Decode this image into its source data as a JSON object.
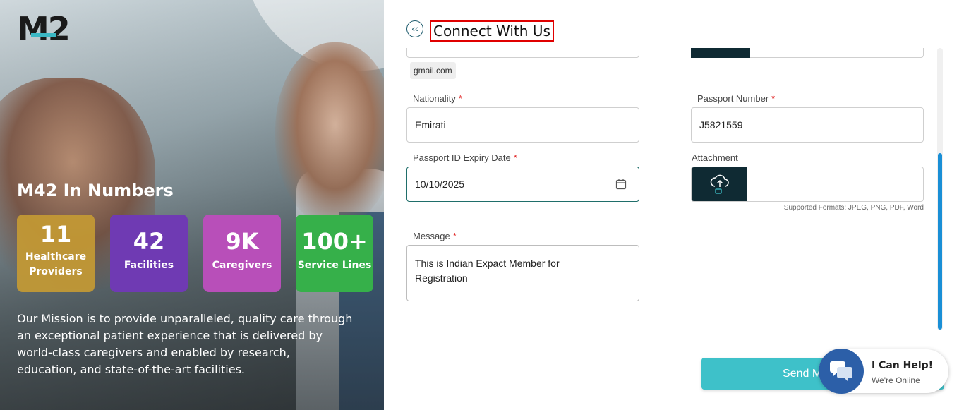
{
  "brand": {
    "logo_text": "M2"
  },
  "hero": {
    "title": "M42 In Numbers",
    "stats": [
      {
        "value": "11",
        "label_lines": [
          "Healthcare",
          "Providers"
        ],
        "color": "#c49a34"
      },
      {
        "value": "42",
        "label_lines": [
          "Facilities"
        ],
        "color": "#6f3ab3"
      },
      {
        "value": "9K",
        "label_lines": [
          "Caregivers"
        ],
        "color": "#b84fb9"
      },
      {
        "value": "100+",
        "label_lines": [
          "Service Lines"
        ],
        "color": "#36b04a"
      }
    ],
    "mission_lines": [
      "Our Mission is to provide unparalleled, quality care through",
      "an exceptional patient experience that is delivered by",
      "world-class caregivers and enabled by research,",
      "education, and state-of-the-art facilities."
    ]
  },
  "page": {
    "title": "Connect With Us",
    "back_icon": "chevron-left-icon"
  },
  "form": {
    "email_suggestion": "gmail.com",
    "nationality": {
      "label": "Nationality",
      "required": "*",
      "value": "Emirati"
    },
    "passport_number": {
      "label": "Passport Number",
      "required": "*",
      "value": "J5821559"
    },
    "passport_expiry": {
      "label": "Passport ID Expiry Date",
      "required": "*",
      "value": "10/10/2025",
      "icon": "calendar-icon"
    },
    "attachment": {
      "label": "Attachment",
      "icon": "cloud-upload-icon",
      "supported": "Supported Formats: JPEG, PNG, PDF, Word"
    },
    "message": {
      "label": "Message",
      "required": "*",
      "value_lines": [
        "This is Indian Expact Member for",
        "Registration"
      ]
    },
    "submit_label": "Send M"
  },
  "chat_widget": {
    "title": "I Can Help!",
    "subtitle": "We're Online",
    "icon": "chat-bubbles-icon",
    "color": "#2c5fa8"
  },
  "colors": {
    "accent": "#3ec1c9",
    "dark": "#0f2a33",
    "required": "#e02020",
    "highlight_border": "#e00000"
  }
}
